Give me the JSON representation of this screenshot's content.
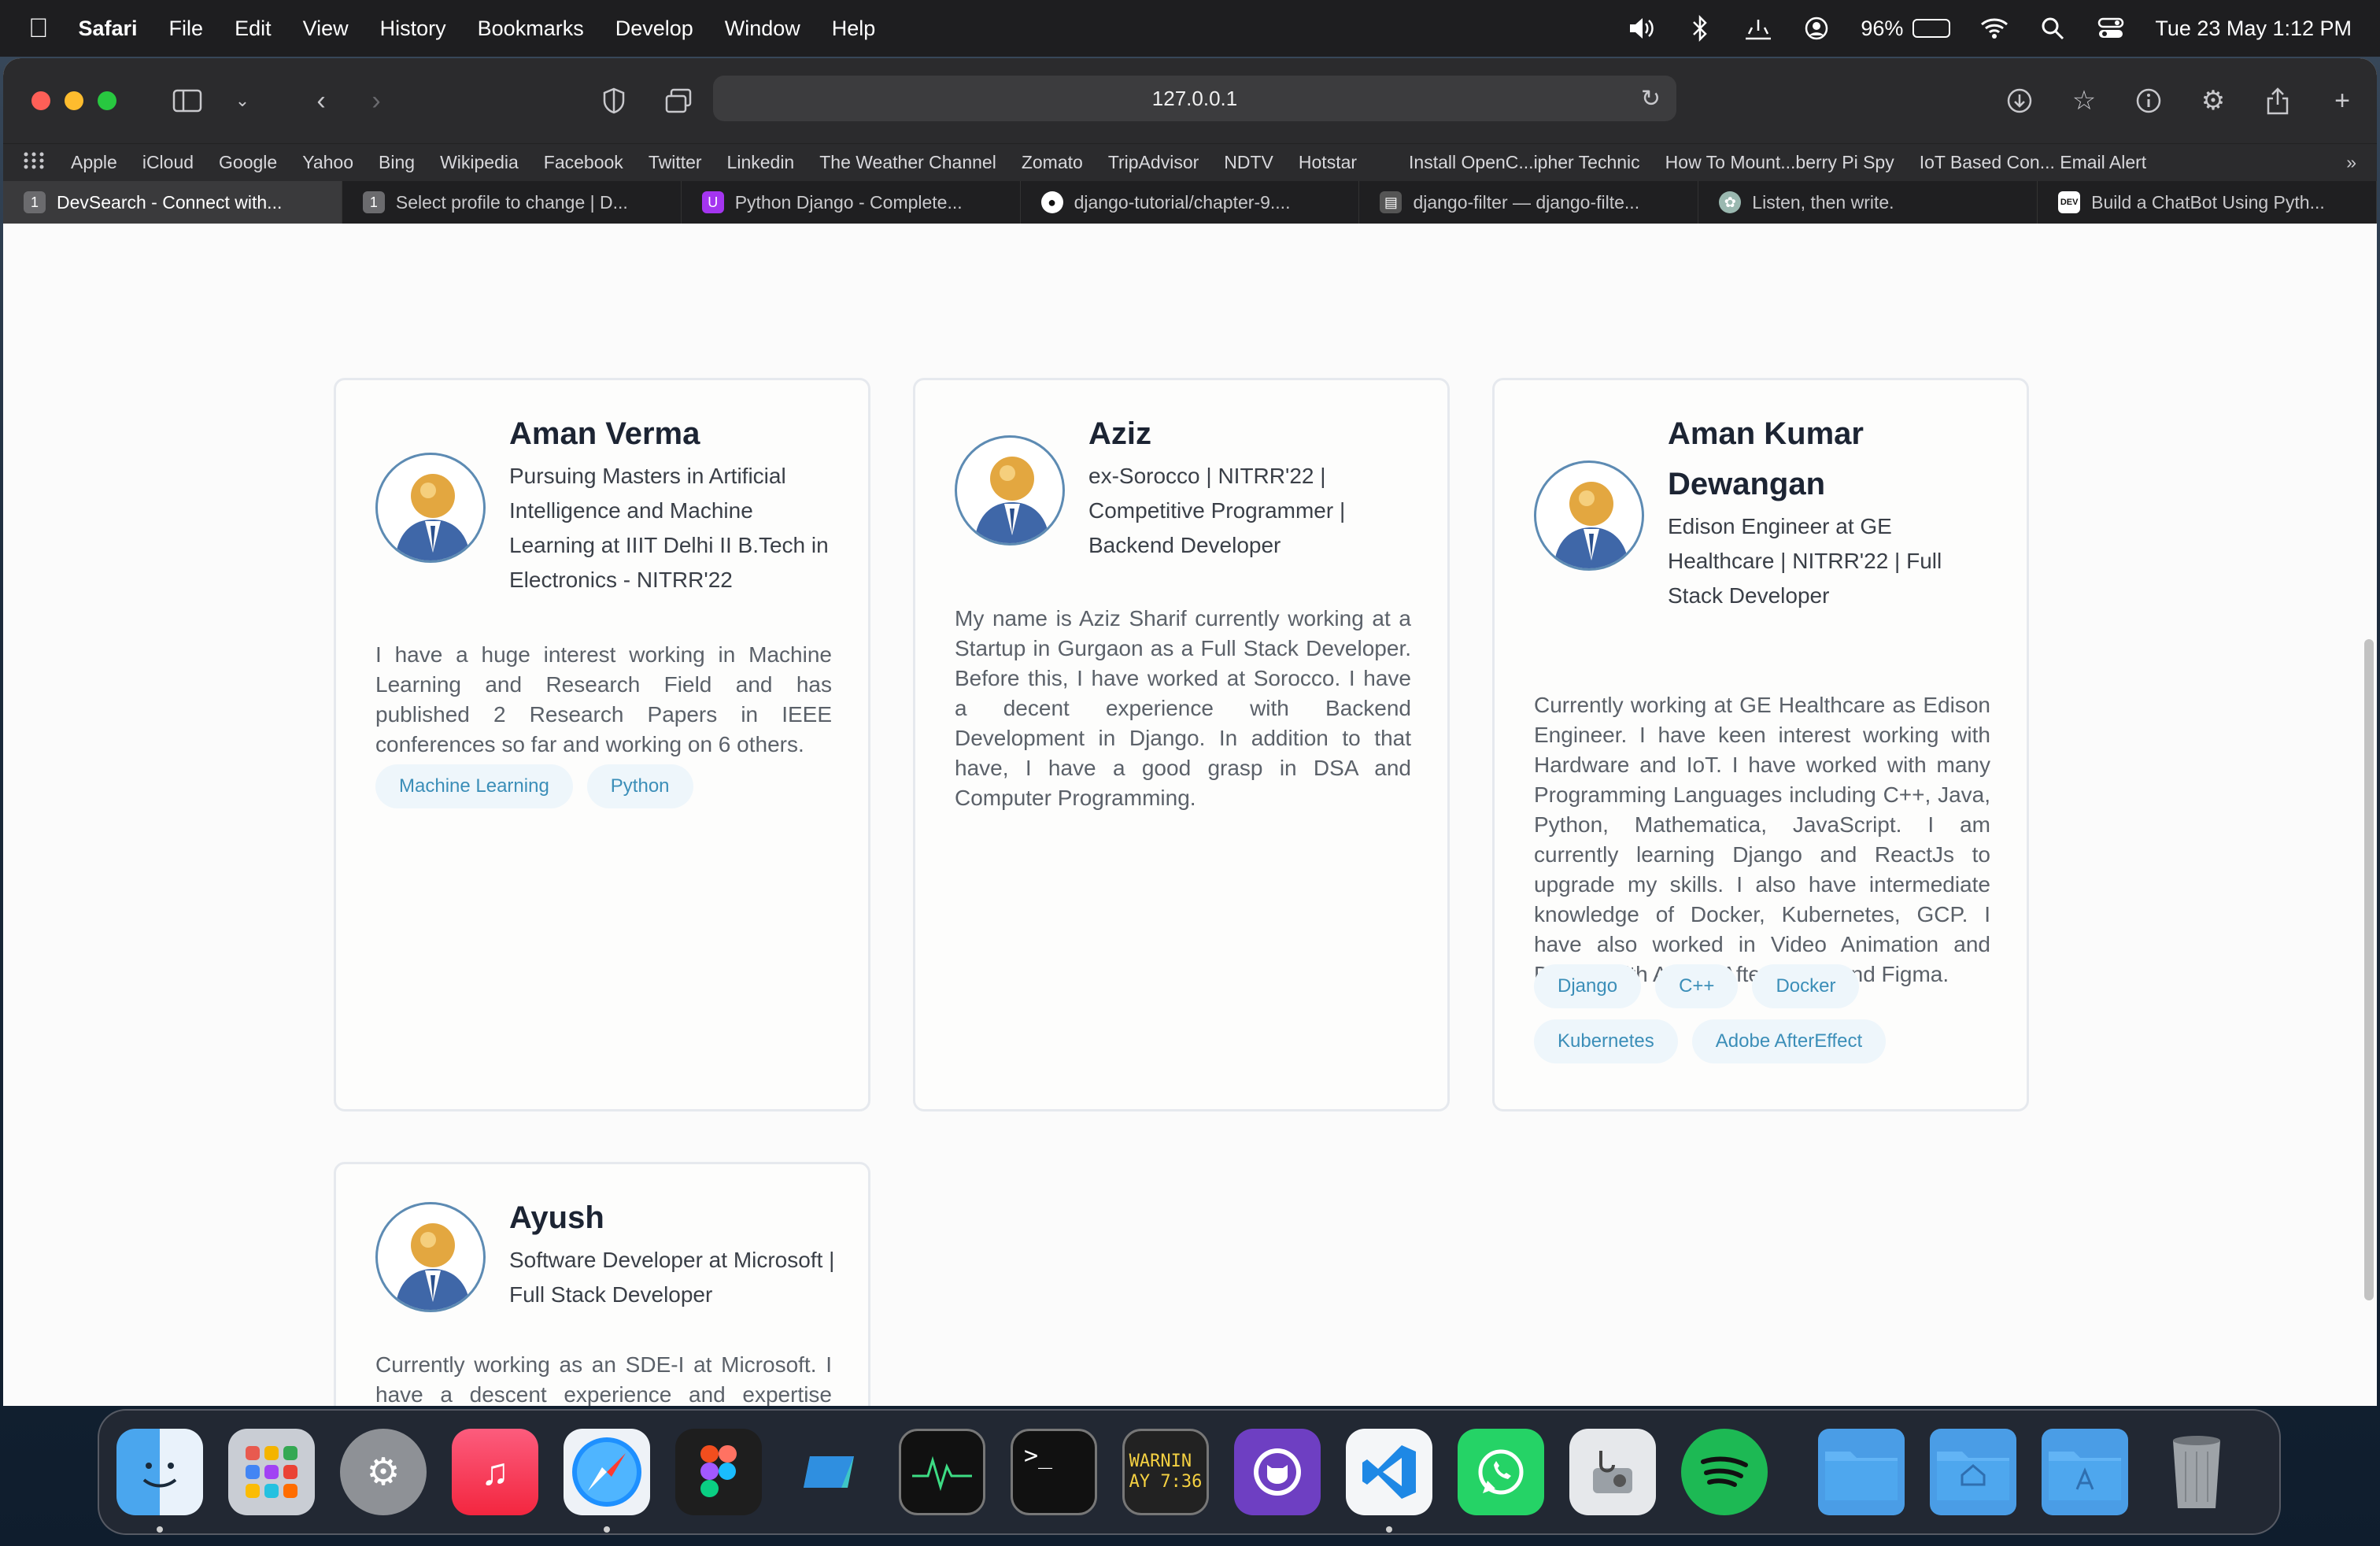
{
  "menubar": {
    "app": "Safari",
    "items": [
      "File",
      "Edit",
      "View",
      "History",
      "Bookmarks",
      "Develop",
      "Window",
      "Help"
    ],
    "battery": "96%",
    "battery_level": 0.96,
    "datetime": "Tue 23 May  1:12 PM"
  },
  "browser": {
    "address": "127.0.0.1",
    "favorites": [
      "Apple",
      "iCloud",
      "Google",
      "Yahoo",
      "Bing",
      "Wikipedia",
      "Facebook",
      "Twitter",
      "Linkedin",
      "The Weather Channel",
      "Zomato",
      "TripAdvisor",
      "NDTV",
      "Hotstar",
      "Install OpenC...ipher Technic",
      "How To Mount...berry Pi Spy",
      "IoT Based Con... Email Alert"
    ],
    "tabs": [
      {
        "title": "DevSearch - Connect with...",
        "icon": "1",
        "active": true
      },
      {
        "title": "Select profile to change | D...",
        "icon": "1",
        "active": false
      },
      {
        "title": "Python Django - Complete...",
        "icon": "udemy",
        "active": false
      },
      {
        "title": "django-tutorial/chapter-9....",
        "icon": "github",
        "active": false
      },
      {
        "title": "django-filter — django-filte...",
        "icon": "doc",
        "active": false
      },
      {
        "title": "Listen, then write.",
        "icon": "chatgpt",
        "active": false
      },
      {
        "title": "Build a ChatBot Using Pyth...",
        "icon": "DEV",
        "active": false
      }
    ]
  },
  "profiles": [
    {
      "name": "Aman Verma",
      "headline": "Pursuing Masters in Artificial Intelligence and Machine Learning at IIIT Delhi II B.Tech in Electronics - NITRR'22",
      "bio": "I have a huge interest working in Machine Learning and Research Field and has published 2 Research Papers in IEEE conferences so far and working on 6 others.",
      "skills": [
        "Machine Learning",
        "Python"
      ]
    },
    {
      "name": "Aziz",
      "headline": "ex-Sorocco | NITRR'22 | Competitive Programmer | Backend Developer",
      "bio": "My name is Aziz Sharif currently working at a Startup in Gurgaon as a Full Stack Developer. Before this, I have worked at Sorocco. I have a decent experience with Backend Development in Django. In addition to that have, I have a good grasp in DSA and Computer Programming.",
      "skills": []
    },
    {
      "name": "Aman Kumar Dewangan",
      "headline": "Edison Engineer at GE Healthcare | NITRR'22 | Full Stack Developer",
      "bio": "Currently working at GE Healthcare as Edison Engineer. I have keen interest working with Hardware and IoT. I have worked with many Programming Languages including C++, Java, Python, Mathematica, JavaScript. I am currently learning Django and ReactJs to upgrade my skills. I also have intermediate knowledge of Docker, Kubernetes, GCP. I have also worked in Video Animation and Design with Adobe Aftereffects and Figma.",
      "skills": [
        "Django",
        "C++",
        "Docker",
        "Kubernetes",
        "Adobe AfterEffect"
      ]
    },
    {
      "name": "Ayush",
      "headline": "Software Developer at Microsoft | Full Stack Developer",
      "bio": "Currently working as an SDE-I at Microsoft. I have a descent experience and expertise working with Django and Flask. I am not so good at Frontend-Development but yeah, I",
      "skills": []
    }
  ],
  "dock": {
    "apps": [
      "finder",
      "launchpad",
      "system-settings",
      "music",
      "safari",
      "figma",
      "tableplus",
      "activity-monitor",
      "terminal",
      "console",
      "github-desktop",
      "vscode",
      "whatsapp",
      "disk-utility",
      "spotify"
    ],
    "console_text": "WARNIN\nAY 7:36",
    "terminal_text": ">_",
    "folders": [
      "downloads-folder",
      "home-folder",
      "applications-folder",
      "trash"
    ]
  }
}
